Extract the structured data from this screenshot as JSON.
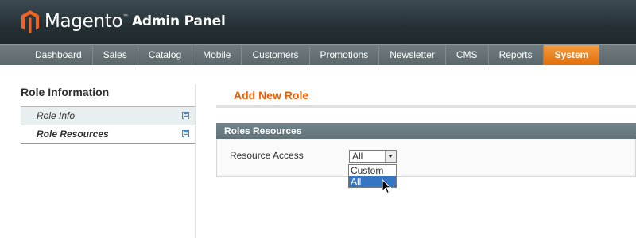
{
  "header": {
    "brand": "Magento",
    "brand_tm": "™",
    "subtitle": "Admin Panel"
  },
  "nav": {
    "items": [
      {
        "label": "Dashboard"
      },
      {
        "label": "Sales"
      },
      {
        "label": "Catalog"
      },
      {
        "label": "Mobile"
      },
      {
        "label": "Customers"
      },
      {
        "label": "Promotions"
      },
      {
        "label": "Newsletter"
      },
      {
        "label": "CMS"
      },
      {
        "label": "Reports"
      },
      {
        "label": "System"
      }
    ],
    "active": "System"
  },
  "sidebar": {
    "title": "Role Information",
    "tabs": [
      {
        "label": "Role Info",
        "icon": "save-icon"
      },
      {
        "label": "Role Resources",
        "icon": "save-icon"
      }
    ],
    "active_tab": "Role Resources"
  },
  "main": {
    "title": "Add New Role",
    "fieldset_title": "Roles Resources",
    "field": {
      "label": "Resource Access",
      "selected": "All",
      "options": [
        "Custom",
        "All"
      ],
      "highlighted": "All"
    }
  },
  "colors": {
    "accent": "#eb5e00",
    "nav_active": "#e26e0c",
    "highlight": "#3476c3"
  }
}
